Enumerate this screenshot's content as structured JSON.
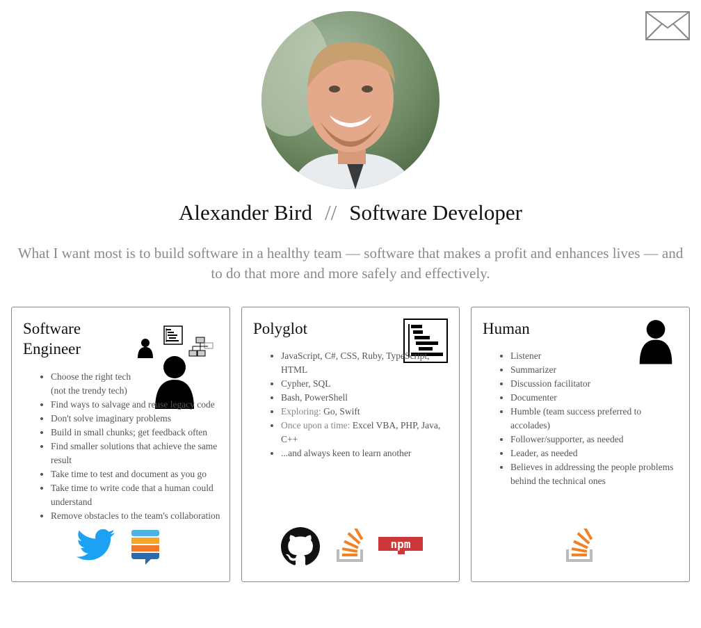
{
  "header": {
    "name": "Alexander Bird",
    "separator": "//",
    "role": "Software Developer",
    "tagline": "What I want most is to build software in a healthy team — software that makes a profit and enhances lives — and to do that more and more safely and effectively.",
    "avatar_icon": "profile-photo",
    "mail_icon": "envelope-icon"
  },
  "cards": {
    "engineer": {
      "title": "Software Engineer",
      "items": [
        "Choose the right tech (not the trendy tech)",
        "Find ways to salvage and reuse legacy code",
        "Don't solve imaginary problems",
        "Build in small chunks; get feedback often",
        "Find smaller solutions that achieve the same result",
        "Take time to test and document as you go",
        "Take time to write code that a human could understand",
        "Remove obstacles to the team's collaboration"
      ],
      "icons": [
        "person-icon",
        "gantt-icon",
        "org-chart-icon",
        "twitter-icon",
        "stackexchange-icon"
      ]
    },
    "polyglot": {
      "title": "Polyglot",
      "items": [
        {
          "prefix": "",
          "text": "JavaScript, C#, CSS, Ruby, TypeScript, HTML"
        },
        {
          "prefix": "",
          "text": "Cypher, SQL"
        },
        {
          "prefix": "",
          "text": "Bash, PowerShell"
        },
        {
          "prefix": "Exploring:",
          "text": "Go, Swift"
        },
        {
          "prefix": "Once upon a time:",
          "text": "Excel VBA, PHP, Java, C++"
        },
        {
          "prefix": "",
          "text": "...and always keen to learn another"
        }
      ],
      "icons": [
        "gantt-icon",
        "github-icon",
        "stackoverflow-icon",
        "npm-icon"
      ],
      "npm_label": "npm"
    },
    "human": {
      "title": "Human",
      "items": [
        "Listener",
        "Summarizer",
        "Discussion facilitator",
        "Documenter",
        "Humble (team success preferred to accolades)",
        "Follower/supporter, as needed",
        "Leader, as needed",
        "Believes in addressing the people problems behind the technical ones"
      ],
      "icons": [
        "person-icon",
        "stackoverflow-icon"
      ]
    }
  },
  "colors": {
    "twitter": "#1da1f2",
    "stackoverflow_orange": "#f48024",
    "stackoverflow_gray": "#bcbbbb",
    "npm_red": "#cb3837",
    "muted_text": "#888888"
  }
}
